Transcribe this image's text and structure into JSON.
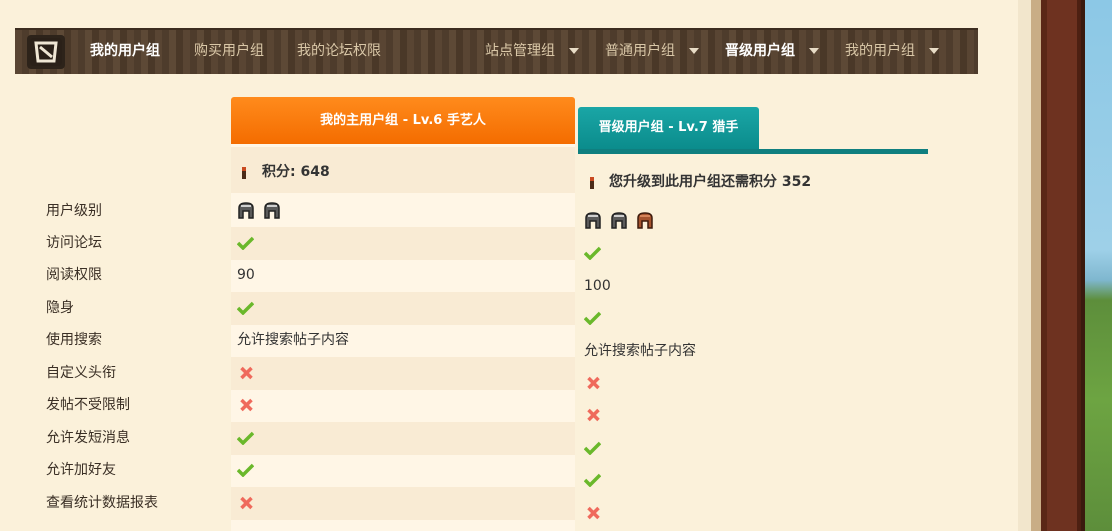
{
  "nav": {
    "items": [
      {
        "label": "我的用户组",
        "active": true
      },
      {
        "label": "购买用户组",
        "active": false
      },
      {
        "label": "我的论坛权限",
        "active": false
      },
      {
        "label": "站点管理组",
        "active": false,
        "dropdown": true
      },
      {
        "label": "普通用户组",
        "active": false,
        "dropdown": true
      },
      {
        "label": "晋级用户组",
        "active": true,
        "dropdown": true
      },
      {
        "label": "我的用户组",
        "active": false,
        "dropdown": true
      }
    ]
  },
  "main_group": {
    "title": "我的主用户组 - Lv.6 手艺人",
    "score_text": "积分: 648"
  },
  "upgrade_group": {
    "title": "晋级用户组 - Lv.7 猎手",
    "score_text": "您升级到此用户组还需积分 352"
  },
  "rows": [
    {
      "label": "用户级别",
      "main": "helmets-2",
      "upgrade": "helmets-3"
    },
    {
      "label": "访问论坛",
      "main": "check",
      "upgrade": "check"
    },
    {
      "label": "阅读权限",
      "main": "90",
      "upgrade": "100"
    },
    {
      "label": "隐身",
      "main": "check",
      "upgrade": "check"
    },
    {
      "label": "使用搜索",
      "main": "允许搜索帖子内容",
      "upgrade": "允许搜索帖子内容"
    },
    {
      "label": "自定义头衔",
      "main": "cross",
      "upgrade": "cross"
    },
    {
      "label": "发帖不受限制",
      "main": "cross",
      "upgrade": "cross"
    },
    {
      "label": "允许发短消息",
      "main": "check",
      "upgrade": "check"
    },
    {
      "label": "允许加好友",
      "main": "check",
      "upgrade": "check"
    },
    {
      "label": "查看统计数据报表",
      "main": "cross",
      "upgrade": "cross"
    }
  ],
  "colors": {
    "accent_orange": "#f47a00",
    "accent_teal": "#11999e",
    "check_green": "#6ab82b",
    "cross_red": "#ef6a5c"
  }
}
